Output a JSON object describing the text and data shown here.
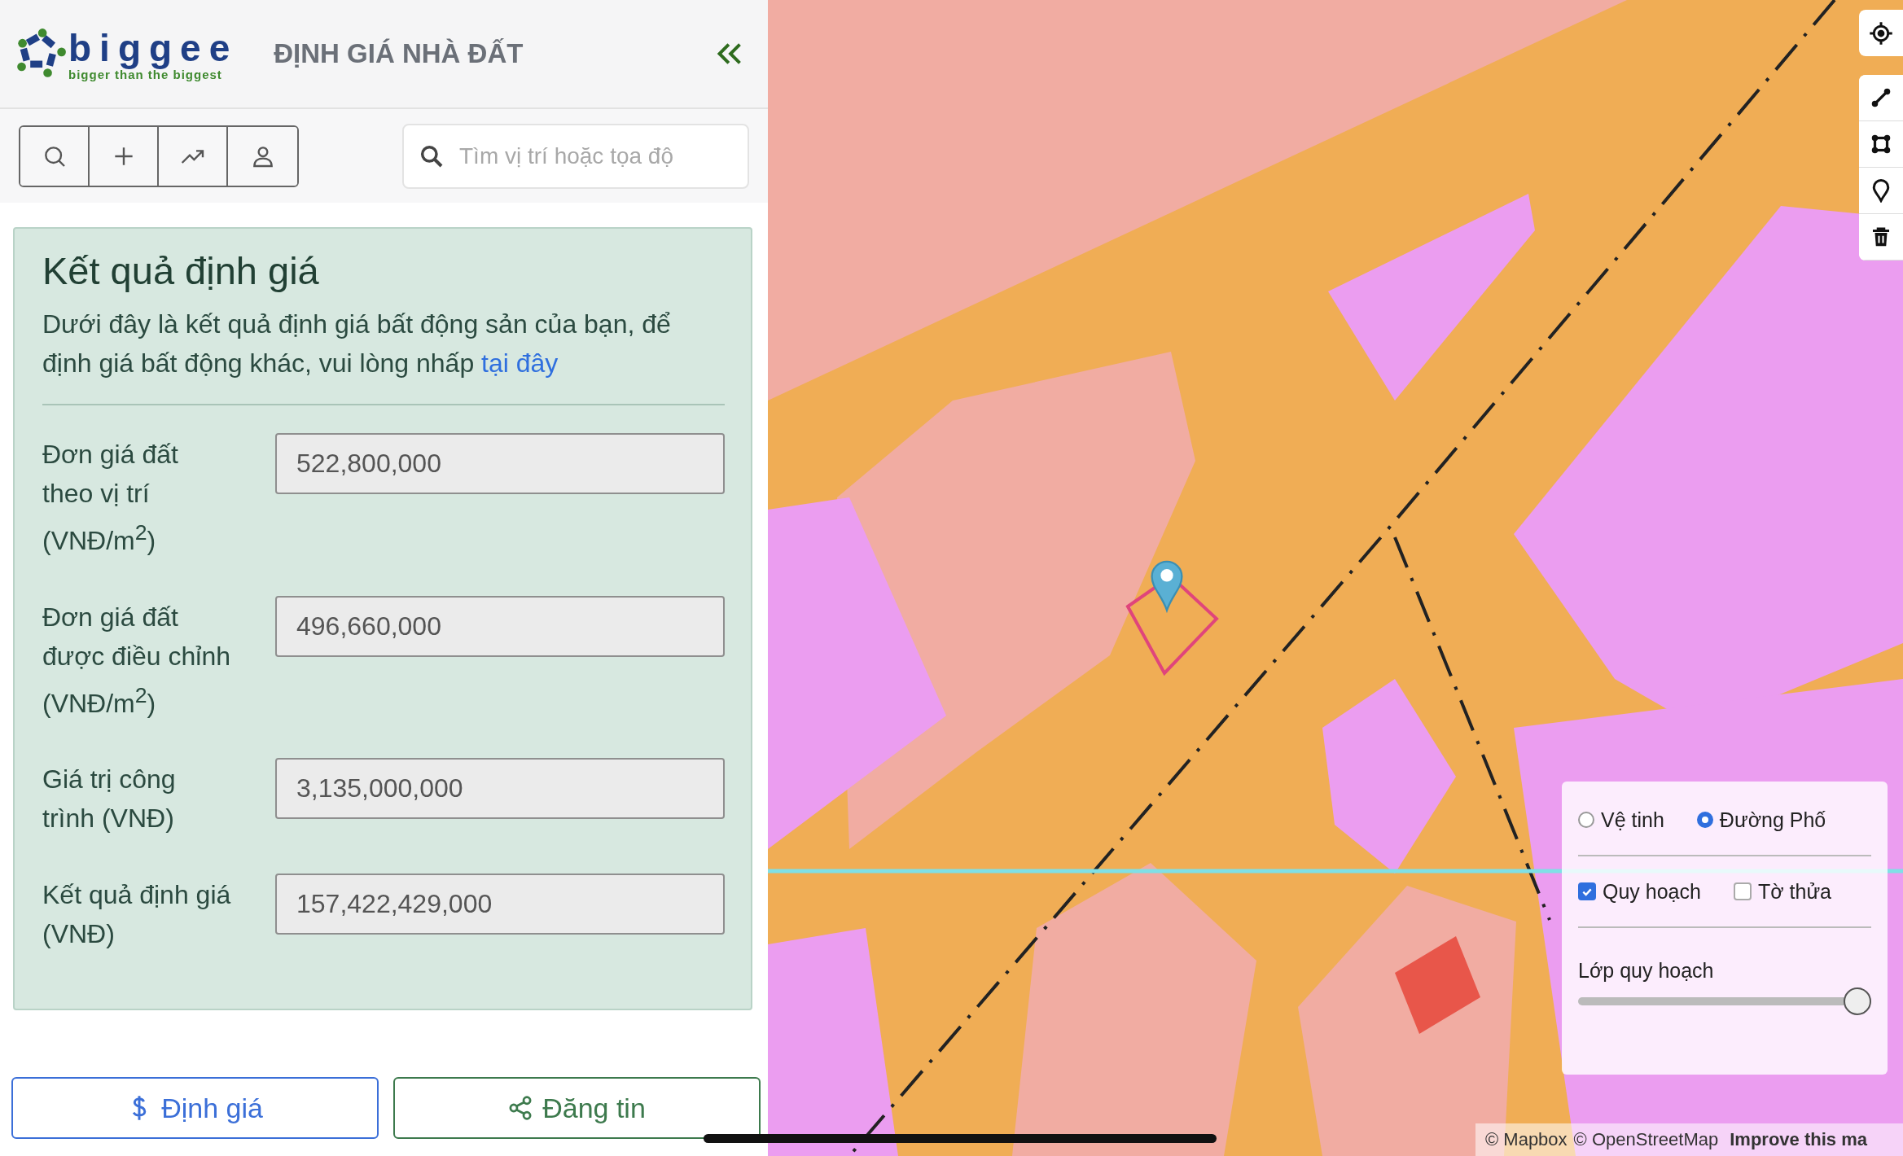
{
  "header": {
    "logo": {
      "wordmark": "biggee",
      "tagline": "bigger than the biggest"
    },
    "title": "ĐỊNH GIÁ NHÀ ĐẤT"
  },
  "search": {
    "placeholder": "Tìm vị trí hoặc tọa độ"
  },
  "result": {
    "title": "Kết quả định giá",
    "intro": "Dưới đây là kết quả định giá bất động sản của bạn, để định giá bất động khác, vui lòng nhấp",
    "link": "tại đây",
    "fields": [
      {
        "label": "Đơn giá đất theo vị trí (VNĐ/m$^{2}$)",
        "value": "522,800,000"
      },
      {
        "label": "Đơn giá đất được điều chỉnh (VNĐ/m$^{2}$)",
        "value": "496,660,000"
      },
      {
        "label": "Giá trị công trình (VNĐ)",
        "value": "3,135,000,000"
      },
      {
        "label": "Kết quả định giá (VNĐ)",
        "value": "157,422,429,000"
      }
    ]
  },
  "actions": [
    {
      "label": "Định giá",
      "kind": "valuate"
    },
    {
      "label": "Đăng tin",
      "kind": "share"
    }
  ],
  "layers": {
    "base": [
      {
        "label": "Vệ tinh",
        "selected": false
      },
      {
        "label": "Đường Phố",
        "selected": true
      }
    ],
    "overlays": [
      {
        "label": "Quy hoạch",
        "checked": true
      },
      {
        "label": "Tờ thửa",
        "checked": false
      }
    ],
    "opacity": {
      "label": "Lớp quy hoạch",
      "level": 1.0
    }
  },
  "attribution": [
    {
      "label": "© Mapbox",
      "bold": false
    },
    {
      "label": "© OpenStreetMap",
      "bold": false
    },
    {
      "label": "Improve this ma",
      "bold": true
    }
  ]
}
